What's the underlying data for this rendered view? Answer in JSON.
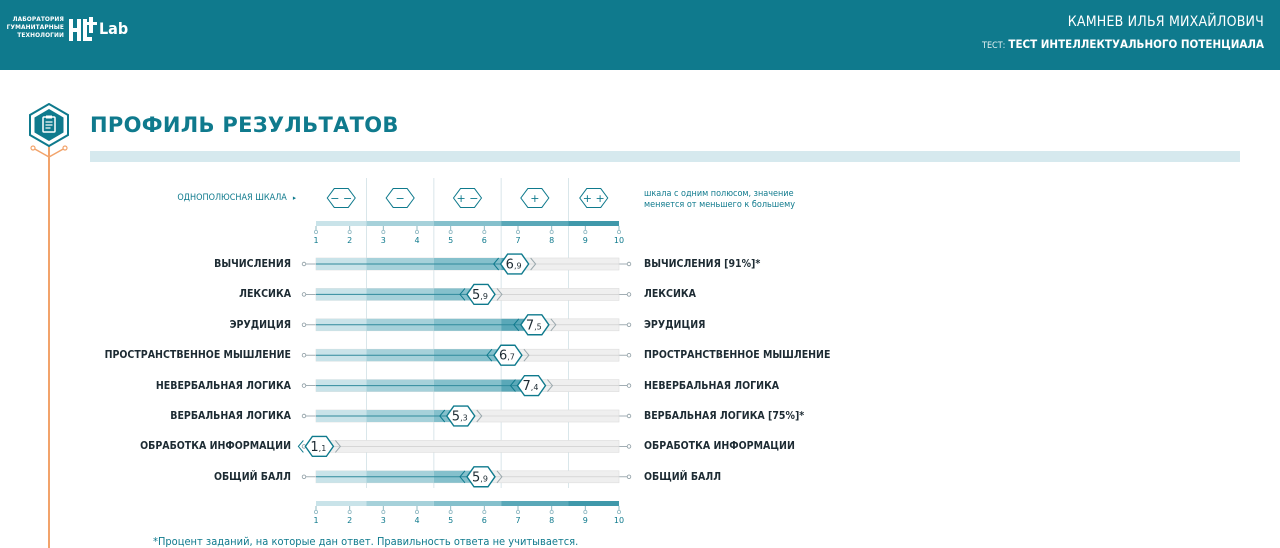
{
  "header": {
    "logo_lines": [
      "ЛАБОРАТОРИЯ",
      "ГУМАНИТАРНЫЕ",
      "ТЕХНОЛОГИИ"
    ],
    "logo_lab": "Lab",
    "user_name": "КАМНЕВ ИЛЬЯ МИХАЙЛОВИЧ",
    "test_prefix": "ТЕСТ:",
    "test_name": "ТЕСТ ИНТЕЛЛЕКТУАЛЬНОГО ПОТЕНЦИАЛА"
  },
  "page_title": "ПРОФИЛЬ РЕЗУЛЬТАТОВ",
  "scale": {
    "label": "ОДНОПОЛЮСНАЯ ШКАЛА",
    "arrow": "▸",
    "description_lines": [
      "шкала с одним полюсом, значение",
      "меняется от меньшего к большему"
    ],
    "zones": [
      {
        "symbol": "− −",
        "from": 1,
        "to": 2.5
      },
      {
        "symbol": "−",
        "from": 2.5,
        "to": 4.5
      },
      {
        "symbol": "+ −",
        "from": 4.5,
        "to": 6.5
      },
      {
        "symbol": "+",
        "from": 6.5,
        "to": 8.5
      },
      {
        "symbol": "+ +",
        "from": 8.5,
        "to": 10
      }
    ],
    "ticks": [
      "1",
      "2",
      "3",
      "4",
      "5",
      "6",
      "7",
      "8",
      "9",
      "10"
    ]
  },
  "colors": {
    "header": "#0f7a8d",
    "accent": "#0f7a8d",
    "zone_shades": [
      "#c9e3e9",
      "#a6d1da",
      "#85c0cc",
      "#5aa8b8",
      "#3f98aa"
    ],
    "track": "#efefef",
    "orange": "#f2a36b"
  },
  "chart_data": {
    "type": "bar",
    "xlim": [
      1,
      10
    ],
    "categories": [
      "ВЫЧИСЛЕНИЯ",
      "ЛЕКСИКА",
      "ЭРУДИЦИЯ",
      "ПРОСТРАНСТВЕННОЕ МЫШЛЕНИЕ",
      "НЕВЕРБАЛЬНАЯ ЛОГИКА",
      "ВЕРБАЛЬНАЯ ЛОГИКА",
      "ОБРАБОТКА ИНФОРМАЦИИ",
      "ОБЩИЙ БАЛЛ"
    ],
    "right_labels": [
      "ВЫЧИСЛЕНИЯ  [91%]*",
      "ЛЕКСИКА",
      "ЭРУДИЦИЯ",
      "ПРОСТРАНСТВЕННОЕ МЫШЛЕНИЕ",
      "НЕВЕРБАЛЬНАЯ ЛОГИКА",
      "ВЕРБАЛЬНАЯ ЛОГИКА  [75%]*",
      "ОБРАБОТКА ИНФОРМАЦИИ",
      "ОБЩИЙ БАЛЛ"
    ],
    "values": [
      6.9,
      5.9,
      7.5,
      6.7,
      7.4,
      5.3,
      1.1,
      5.9
    ],
    "value_labels": [
      {
        "int": "6",
        "dec": ",9"
      },
      {
        "int": "5",
        "dec": ",9"
      },
      {
        "int": "7",
        "dec": ",5"
      },
      {
        "int": "6",
        "dec": ",7"
      },
      {
        "int": "7",
        "dec": ",4"
      },
      {
        "int": "5",
        "dec": ",3"
      },
      {
        "int": "1",
        "dec": ",1"
      },
      {
        "int": "5",
        "dec": ",9"
      }
    ]
  },
  "footnote": "*Процент заданий, на которые дан ответ. Правильность ответа не учитывается."
}
